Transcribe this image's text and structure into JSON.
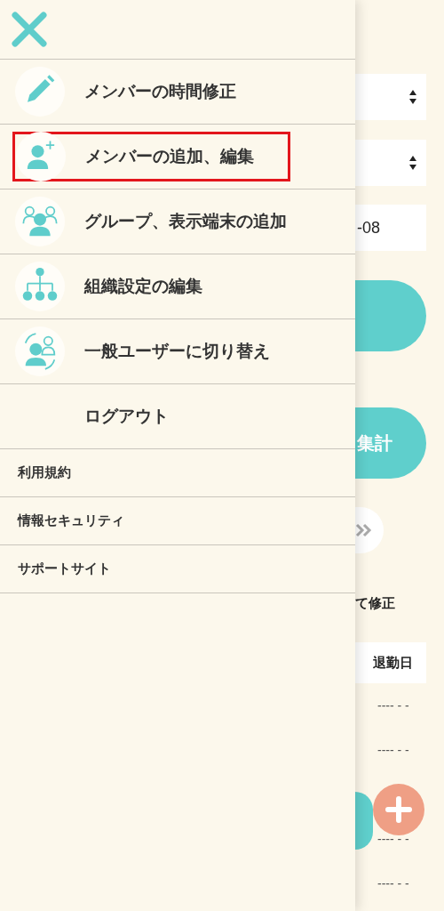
{
  "menu": {
    "items": [
      {
        "kind": "pencil",
        "label": "メンバーの時間修正",
        "highlighted": false
      },
      {
        "kind": "add-member",
        "label": "メンバーの追加、編集",
        "highlighted": true
      },
      {
        "kind": "group",
        "label": "グループ、表示端末の追加",
        "highlighted": false
      },
      {
        "kind": "org",
        "label": "組織設定の編集",
        "highlighted": false
      },
      {
        "kind": "switch",
        "label": "一般ユーザーに切り替え",
        "highlighted": false
      },
      {
        "kind": "plain",
        "label": "ログアウト",
        "highlighted": false
      }
    ]
  },
  "links": [
    "利用規約",
    "情報セキュリティ",
    "サポートサイト"
  ],
  "background": {
    "date_value": "-08",
    "aggregate_button": "集計",
    "note": "て修正",
    "table": {
      "columns": [
        "退勤日"
      ],
      "rows": [
        [
          "---- - -"
        ],
        [
          "---- - -"
        ],
        [
          "---- - -"
        ],
        [
          "---- - -"
        ]
      ]
    }
  }
}
